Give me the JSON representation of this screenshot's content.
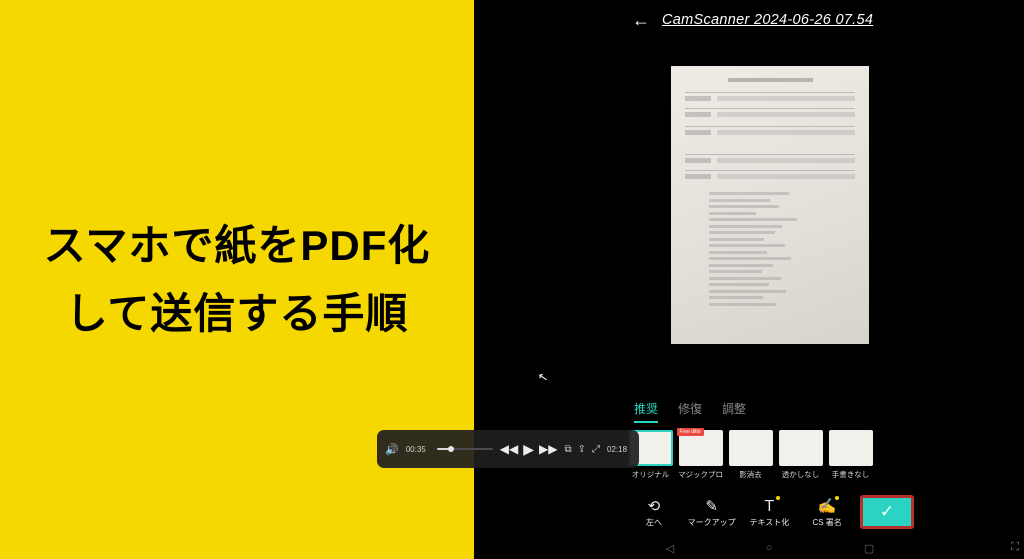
{
  "title": {
    "line1": "スマホで紙をPDF化",
    "line2": "して送信する手順"
  },
  "app": {
    "back_icon": "←",
    "header_title": "CamScanner 2024-06-26 07.54"
  },
  "tabs": {
    "t1": "推奨",
    "t2": "修復",
    "t3": "調整"
  },
  "filters": {
    "f1": "オリジナル",
    "f2": "マジックプロ",
    "f2_badge": "Free ditto",
    "f3": "影消去",
    "f4": "透かしなし",
    "f5": "手書きなし"
  },
  "bottom": {
    "b1": "左へ",
    "b2": "マークアップ",
    "b3": "テキスト化",
    "b4": "CS 署名",
    "confirm": "✓"
  },
  "video": {
    "volume_icon": "🔊",
    "current": "00:35",
    "duration": "02:18",
    "rewind": "◀◀",
    "play": "▶",
    "forward": "▶▶",
    "pip": "⧉",
    "share": "⇪",
    "expand": "⤢"
  },
  "nav": {
    "back": "◁",
    "home": "○",
    "recent": "▢",
    "expand_corner": "⛶"
  }
}
